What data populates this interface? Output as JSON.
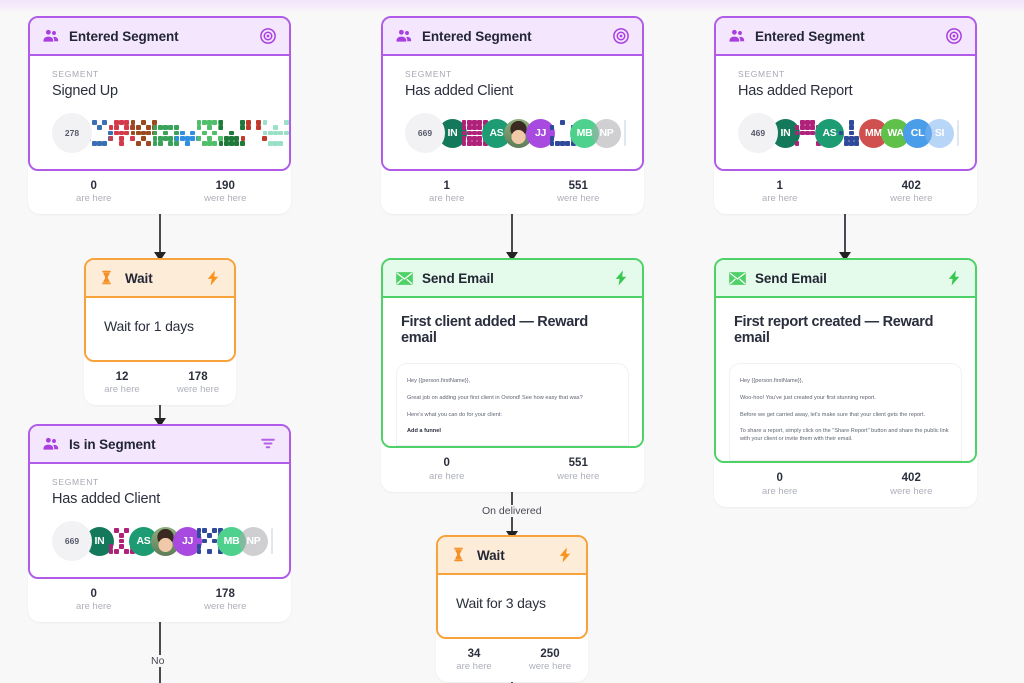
{
  "theme": {
    "purple": "#b05ce8",
    "purple_head": "#f4e6fc",
    "orange": "#f7a23b",
    "orange_head": "#fdecd7",
    "green": "#4ed167",
    "green_head": "#e4faea",
    "canvas_bg": "#f8f8f9"
  },
  "labels": {
    "segment_caption": "SEGMENT",
    "are_here": "are here",
    "were_here": "were here"
  },
  "nodes": [
    {
      "id": "entered-segment-signed-up",
      "type": "trigger",
      "title": "Entered Segment",
      "icon": "people-icon",
      "action_icon": "target-icon",
      "segment": "Signed Up",
      "audience_count": "278",
      "avatars": [
        {
          "kind": "identicon",
          "color": "#3a6fb5"
        },
        {
          "kind": "identicon",
          "color": "#d33b4a"
        },
        {
          "kind": "identicon",
          "color": "#9a4a1e"
        },
        {
          "kind": "identicon",
          "color": "#3aa35a"
        },
        {
          "kind": "identicon",
          "color": "#2f8fe0"
        },
        {
          "kind": "identicon",
          "color": "#4fbf6a"
        },
        {
          "kind": "identicon",
          "color": "#1f7a3a"
        },
        {
          "kind": "identicon",
          "color": "#c03a2b"
        },
        {
          "kind": "identicon",
          "color": "#46c89a"
        }
      ],
      "are_here": "0",
      "were_here": "190"
    },
    {
      "id": "wait-1-days",
      "type": "wait",
      "title": "Wait",
      "icon": "hourglass-icon",
      "action_icon": "lightning-icon",
      "body": "Wait for 1 days",
      "are_here": "12",
      "were_here": "178"
    },
    {
      "id": "is-in-segment-has-added-client",
      "type": "condition",
      "title": "Is in Segment",
      "icon": "people-icon",
      "action_icon": "filter-icon",
      "segment": "Has added Client",
      "audience_count": "669",
      "avatars": [
        {
          "kind": "initials",
          "text": "IN",
          "color": "#14795a"
        },
        {
          "kind": "identicon",
          "color": "#b0217a"
        },
        {
          "kind": "initials",
          "text": "AS",
          "color": "#1d9b72"
        },
        {
          "kind": "photo"
        },
        {
          "kind": "initials",
          "text": "JJ",
          "color": "#a84ae0"
        },
        {
          "kind": "identicon",
          "color": "#2f4a9b"
        },
        {
          "kind": "initials",
          "text": "MB",
          "color": "#4ed18d"
        },
        {
          "kind": "initials",
          "text": "NP",
          "color": "#a9a9ae"
        }
      ],
      "are_here": "0",
      "were_here": "178",
      "branch_label": "No"
    },
    {
      "id": "entered-segment-has-added-client",
      "type": "trigger",
      "title": "Entered Segment",
      "icon": "people-icon",
      "action_icon": "target-icon",
      "segment": "Has added Client",
      "audience_count": "669",
      "avatars": [
        {
          "kind": "initials",
          "text": "IN",
          "color": "#14795a"
        },
        {
          "kind": "identicon",
          "color": "#b0217a"
        },
        {
          "kind": "initials",
          "text": "AS",
          "color": "#1d9b72"
        },
        {
          "kind": "photo"
        },
        {
          "kind": "initials",
          "text": "JJ",
          "color": "#a84ae0"
        },
        {
          "kind": "identicon",
          "color": "#2f4a9b"
        },
        {
          "kind": "initials",
          "text": "MB",
          "color": "#4ed18d"
        },
        {
          "kind": "initials",
          "text": "NP",
          "color": "#a9a9ae"
        }
      ],
      "are_here": "1",
      "were_here": "551"
    },
    {
      "id": "send-email-first-client-added",
      "type": "email",
      "title": "Send Email",
      "icon": "envelope-icon",
      "action_icon": "lightning-icon",
      "subject": "First client added — Reward email",
      "preview": [
        "Hey {{person.firstName}},",
        "Great job on adding your first client in Oviond! See how easy that was?",
        "Here's what you can do for your client:"
      ],
      "preview_strong": "Add a funnel",
      "are_here": "0",
      "were_here": "551",
      "branch_label": "On delivered"
    },
    {
      "id": "wait-3-days",
      "type": "wait",
      "title": "Wait",
      "icon": "hourglass-icon",
      "action_icon": "lightning-icon",
      "body": "Wait for 3 days",
      "are_here": "34",
      "were_here": "250"
    },
    {
      "id": "entered-segment-has-added-report",
      "type": "trigger",
      "title": "Entered Segment",
      "icon": "people-icon",
      "action_icon": "target-icon",
      "segment": "Has added Report",
      "audience_count": "469",
      "avatars": [
        {
          "kind": "initials",
          "text": "IN",
          "color": "#14795a"
        },
        {
          "kind": "identicon",
          "color": "#b0217a"
        },
        {
          "kind": "initials",
          "text": "AS",
          "color": "#1d9b72"
        },
        {
          "kind": "identicon",
          "color": "#2f4a9b"
        },
        {
          "kind": "initials",
          "text": "MM",
          "color": "#d05050"
        },
        {
          "kind": "initials",
          "text": "WA",
          "color": "#5fc04a"
        },
        {
          "kind": "initials",
          "text": "CL",
          "color": "#4a9de8"
        },
        {
          "kind": "initials",
          "text": "SI",
          "color": "#7eb4f0"
        }
      ],
      "are_here": "1",
      "were_here": "402"
    },
    {
      "id": "send-email-first-report-created",
      "type": "email",
      "title": "Send Email",
      "icon": "envelope-icon",
      "action_icon": "lightning-icon",
      "subject": "First report created — Reward email",
      "preview": [
        "Hey {{person.firstName}},",
        "Woo-hoo! You've just created your first stunning report.",
        "Before we get carried away, let's make sure that your client gets the report.",
        "To share a report, simply click on the \"Share Report\" button and share the public link with your client or invite them with their email."
      ],
      "preview_strong": "",
      "are_here": "0",
      "were_here": "402"
    }
  ]
}
